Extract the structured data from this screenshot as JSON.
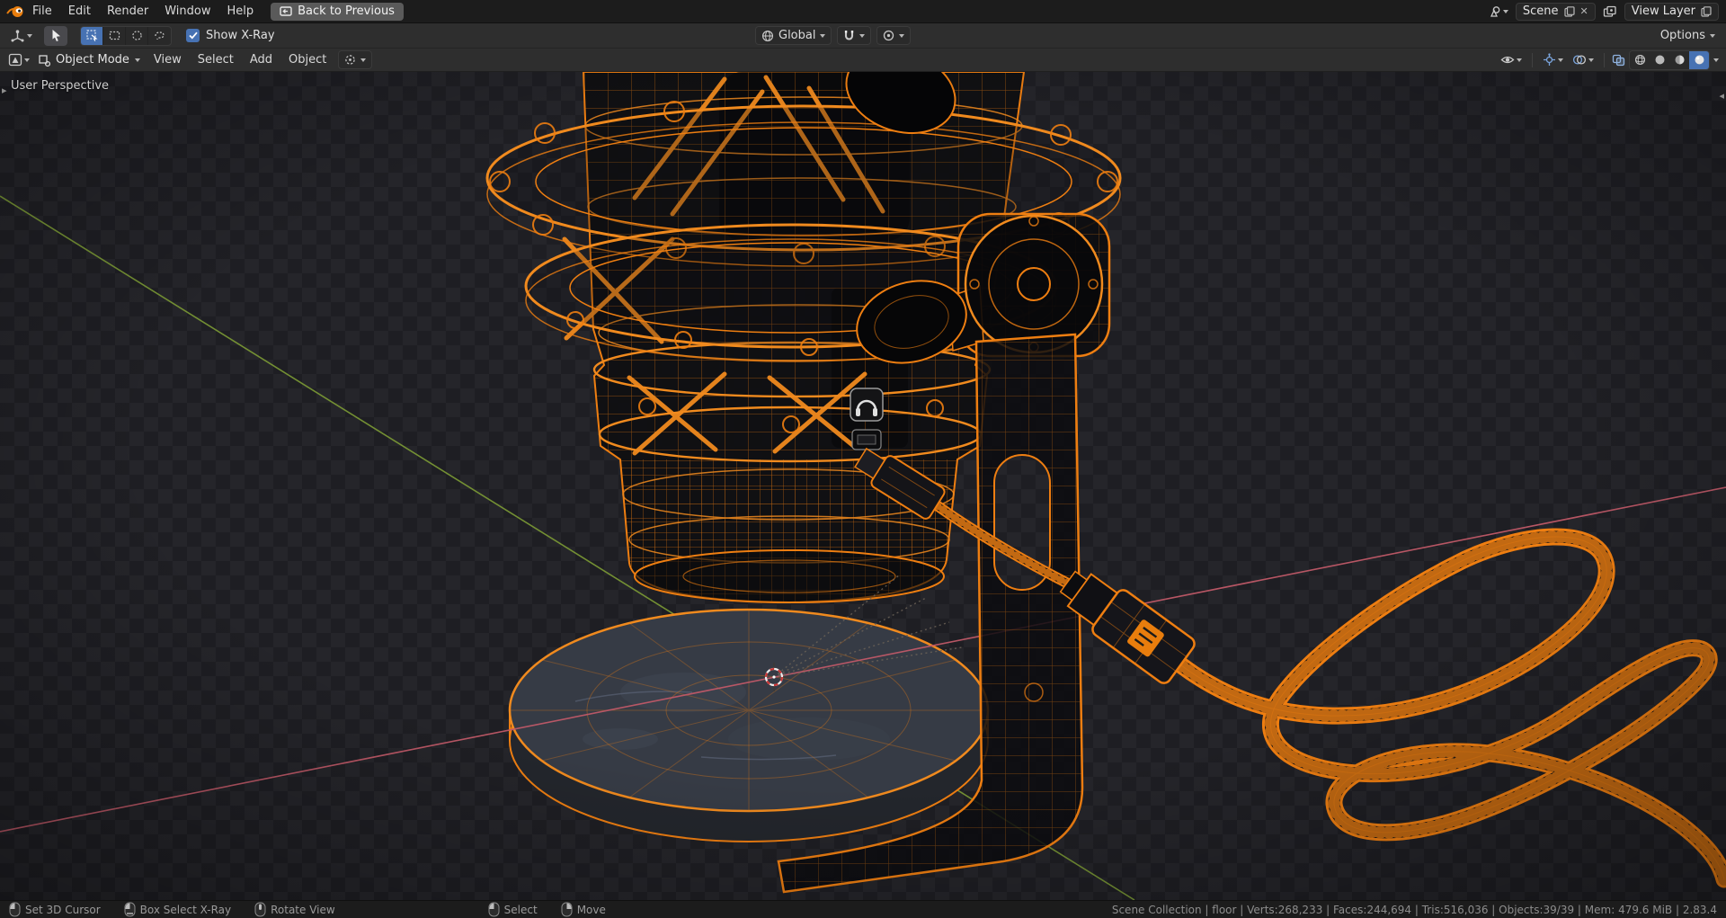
{
  "topbar": {
    "menus": [
      "File",
      "Edit",
      "Render",
      "Window",
      "Help"
    ],
    "back_button": "Back to Previous",
    "scene_field": "Scene",
    "view_layer_field": "View Layer"
  },
  "tool_settings": {
    "show_xray_label": "Show X-Ray",
    "orientation_value": "Global",
    "options_label": "Options"
  },
  "viewport_header": {
    "mode_value": "Object Mode",
    "menus": [
      "View",
      "Select",
      "Add",
      "Object"
    ]
  },
  "viewport": {
    "perspective_label": "User Perspective"
  },
  "statusbar": {
    "hints": [
      {
        "label": "Set 3D Cursor"
      },
      {
        "label": "Box Select X-Ray"
      },
      {
        "label": "Rotate View"
      },
      {
        "label": "Select"
      },
      {
        "label": "Move"
      }
    ],
    "stats": "Scene Collection | floor | Verts:268,233 | Faces:244,694 | Tris:516,036 | Objects:39/39 | Mem: 479.6 MiB | 2.83.4"
  },
  "colors": {
    "wireframe": "#ee7e11",
    "accent_blue": "#4772b3",
    "axis_green": "#7d9c35",
    "axis_red": "#c05968"
  }
}
